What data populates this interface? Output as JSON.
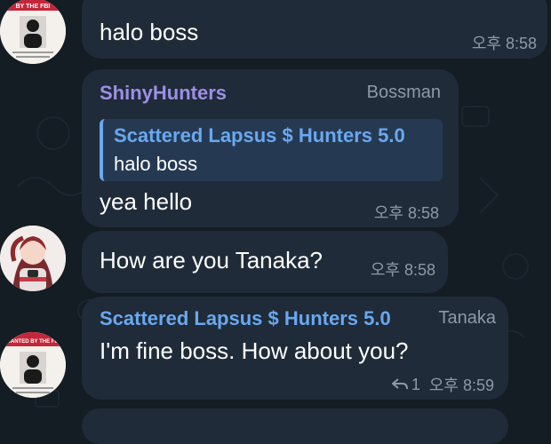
{
  "messages": [
    {
      "text": "halo boss",
      "time": "오후 8:58"
    },
    {
      "sender": "ShinyHunters",
      "role": "Bossman",
      "reply_to": {
        "sender": "Scattered Lapsus $ Hunters 5.0",
        "text": "halo boss"
      },
      "text": "yea hello",
      "time": "오후 8:58"
    },
    {
      "text": "How are you Tanaka?",
      "time": "오후 8:58"
    },
    {
      "sender": "Scattered Lapsus $ Hunters 5.0",
      "role": "Tanaka",
      "text": "I'm fine boss. How about you?",
      "replies": "1",
      "time": "오후 8:59"
    }
  ],
  "avatars": {
    "wanted_poster_top": "BY THE FBI",
    "wanted_poster_bottom": "WANTED BY THE FBI"
  },
  "colors": {
    "background": "#141c24",
    "bubble": "#1f2b38",
    "sender_shinyhunters": "#9e8fe6",
    "sender_scattered": "#6aa8f0",
    "time": "#8d9aa6"
  },
  "icons": [
    "reply-arrow-icon"
  ]
}
